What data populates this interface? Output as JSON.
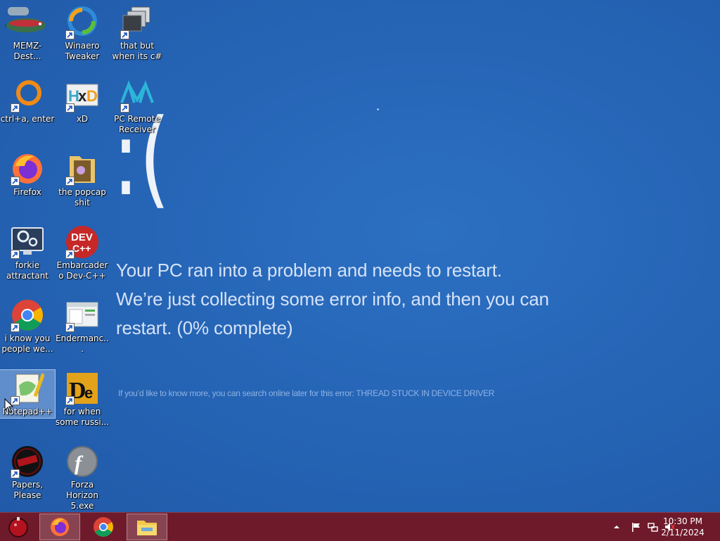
{
  "desktop": {
    "icons": [
      {
        "label": "MEMZ-Dest...",
        "icon": "fish-icon"
      },
      {
        "label": "Winaero Tweaker",
        "icon": "winaero-icon"
      },
      {
        "label": "that but when its c#",
        "icon": "stacked-windows-icon"
      },
      {
        "label": "ctrl+a, enter",
        "icon": "orange-ring-icon"
      },
      {
        "label": "xD",
        "icon": "hxd-icon"
      },
      {
        "label": "PC Remote Receiver",
        "icon": "pc-remote-icon"
      },
      {
        "label": "Firefox",
        "icon": "firefox-icon"
      },
      {
        "label": "the popcap shit",
        "icon": "folder-icon"
      },
      {
        "label": "forkie attractant",
        "icon": "settings-monitor-icon"
      },
      {
        "label": "Embarcadero Dev-C++",
        "icon": "devcpp-icon"
      },
      {
        "label": "i know you people we...",
        "icon": "chrome-icon"
      },
      {
        "label": "Endermanc...",
        "icon": "window-app-icon"
      },
      {
        "label": "Notepad++",
        "icon": "notepadpp-icon"
      },
      {
        "label": "for when some russi...",
        "icon": "de-icon"
      },
      {
        "label": "Papers, Please",
        "icon": "papers-please-icon"
      },
      {
        "label": "Forza Horizon 5.exe",
        "icon": "flash-icon"
      }
    ]
  },
  "bsod": {
    "face": ":(",
    "message": "Your PC ran into a problem and needs to restart. We’re just collecting some error info, and then you can restart. (0% complete)",
    "detail": "If you’d like to know more, you can search online later for this error: THREAD STUCK IN DEVICE DRIVER"
  },
  "taskbar": {
    "items": [
      "start-orb",
      "firefox",
      "chrome",
      "file-explorer"
    ],
    "clock_time": "10:30 PM",
    "clock_date": "2/11/2024",
    "colors": {
      "taskbar": "#6e1a2b",
      "bsod": "#2563b4"
    }
  }
}
